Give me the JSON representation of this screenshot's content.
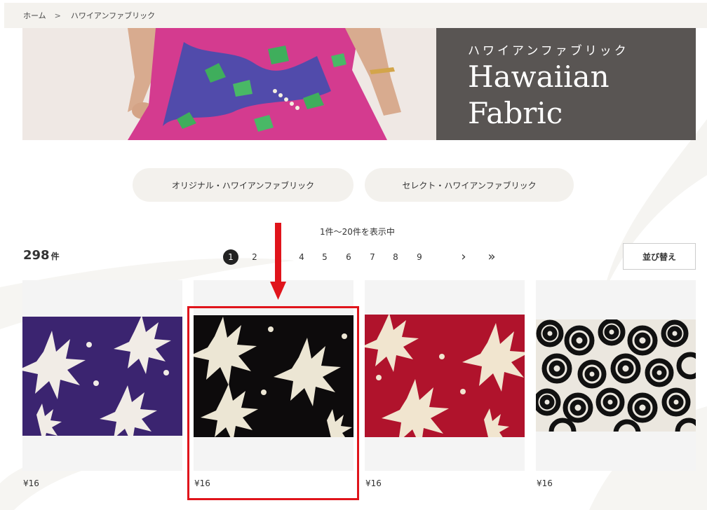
{
  "breadcrumb": {
    "home": "ホーム",
    "separator": ">",
    "current": "ハワイアンファブリック"
  },
  "hero": {
    "title_jp": "ハワイアンファブリック",
    "title_en_line1": "Hawaiian",
    "title_en_line2": "Fabric"
  },
  "categories": [
    {
      "label": "オリジナル・ハワイアンファブリック"
    },
    {
      "label": "セレクト・ハワイアンファブリック"
    }
  ],
  "results": {
    "showing": "1件〜20件を表示中",
    "total": "298",
    "unit": "件"
  },
  "pagination": {
    "pages": [
      "1",
      "2",
      "4",
      "5",
      "6",
      "7",
      "8",
      "9"
    ],
    "current": "1",
    "next": "›",
    "last": "»"
  },
  "sort": {
    "label": "並び替え"
  },
  "products": [
    {
      "price": "¥16",
      "swatch": "purple-floral",
      "color": "#3b2470"
    },
    {
      "price": "¥16",
      "swatch": "black-floral",
      "color": "#0d0b0c"
    },
    {
      "price": "¥16",
      "swatch": "red-floral",
      "color": "#b0132c"
    },
    {
      "price": "¥16",
      "swatch": "black-white-roses",
      "color": "#111111"
    }
  ],
  "annotation": {
    "color": "#e0141b"
  }
}
